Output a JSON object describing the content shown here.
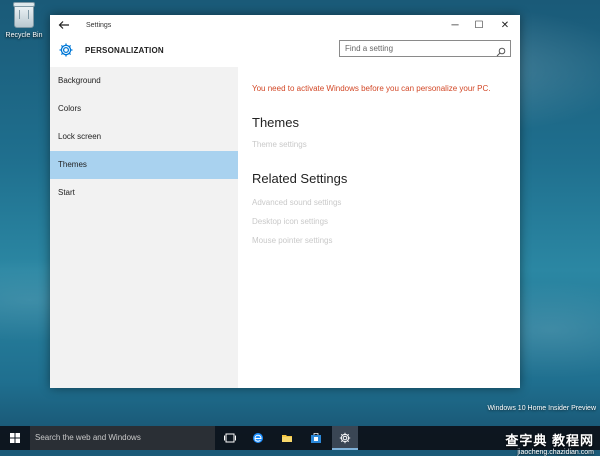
{
  "desktop": {
    "icons": [
      {
        "label": "Recycle Bin",
        "icon": "recycle-bin-icon"
      }
    ]
  },
  "window": {
    "title": "Settings",
    "back_icon": "back-arrow-icon",
    "controls": {
      "minimize": "─",
      "maximize": "☐",
      "close": "✕"
    }
  },
  "header": {
    "icon": "gear-icon",
    "title": "PERSONALIZATION",
    "search": {
      "placeholder": "Find a setting",
      "value": "",
      "icon": "search-icon"
    }
  },
  "nav": {
    "items": [
      {
        "label": "Background",
        "active": false
      },
      {
        "label": "Colors",
        "active": false
      },
      {
        "label": "Lock screen",
        "active": false
      },
      {
        "label": "Themes",
        "active": true
      },
      {
        "label": "Start",
        "active": false
      }
    ]
  },
  "content": {
    "warning": "You need to activate Windows before you can personalize your PC.",
    "themes_heading": "Themes",
    "theme_settings_link": "Theme settings",
    "related_heading": "Related Settings",
    "related_links": [
      "Advanced sound settings",
      "Desktop icon settings",
      "Mouse pointer settings"
    ]
  },
  "colors": {
    "warning": "#d24726",
    "nav_active": "#a9d2ef",
    "accent": "#0078d7"
  },
  "taskbar": {
    "search_placeholder": "Search the web and Windows",
    "apps": [
      "task-view-icon",
      "edge-icon",
      "file-explorer-icon",
      "store-icon",
      "settings-icon"
    ],
    "active_app": "settings-icon"
  },
  "watermark": {
    "line1": "Windows 10 Home Insider Preview",
    "site_main": "查字典 教程网",
    "site_url": "jiaocheng.chazidian.com"
  }
}
